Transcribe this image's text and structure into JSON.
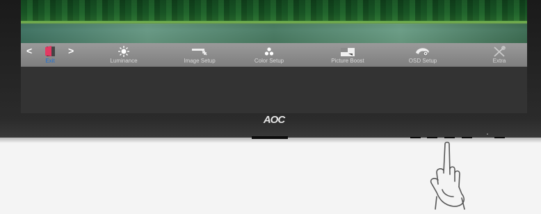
{
  "osd": {
    "left_arrow": "<",
    "right_arrow": ">",
    "items": [
      {
        "label": "Exit",
        "icon": "exit-icon",
        "active": true
      },
      {
        "label": "Luminance",
        "icon": "sun-icon"
      },
      {
        "label": "Image Setup",
        "icon": "image-setup-icon"
      },
      {
        "label": "Color Setup",
        "icon": "color-dots-icon"
      },
      {
        "label": "Picture Boost",
        "icon": "picture-boost-icon"
      },
      {
        "label": "OSD Setup",
        "icon": "osd-setup-icon"
      },
      {
        "label": "Extra",
        "icon": "extra-tools-icon"
      }
    ]
  },
  "monitor": {
    "brand": "AOC"
  },
  "colors": {
    "active_label": "#1e6fd0",
    "menubar": "#8c8c8c",
    "bezel": "#1f1f1f"
  }
}
